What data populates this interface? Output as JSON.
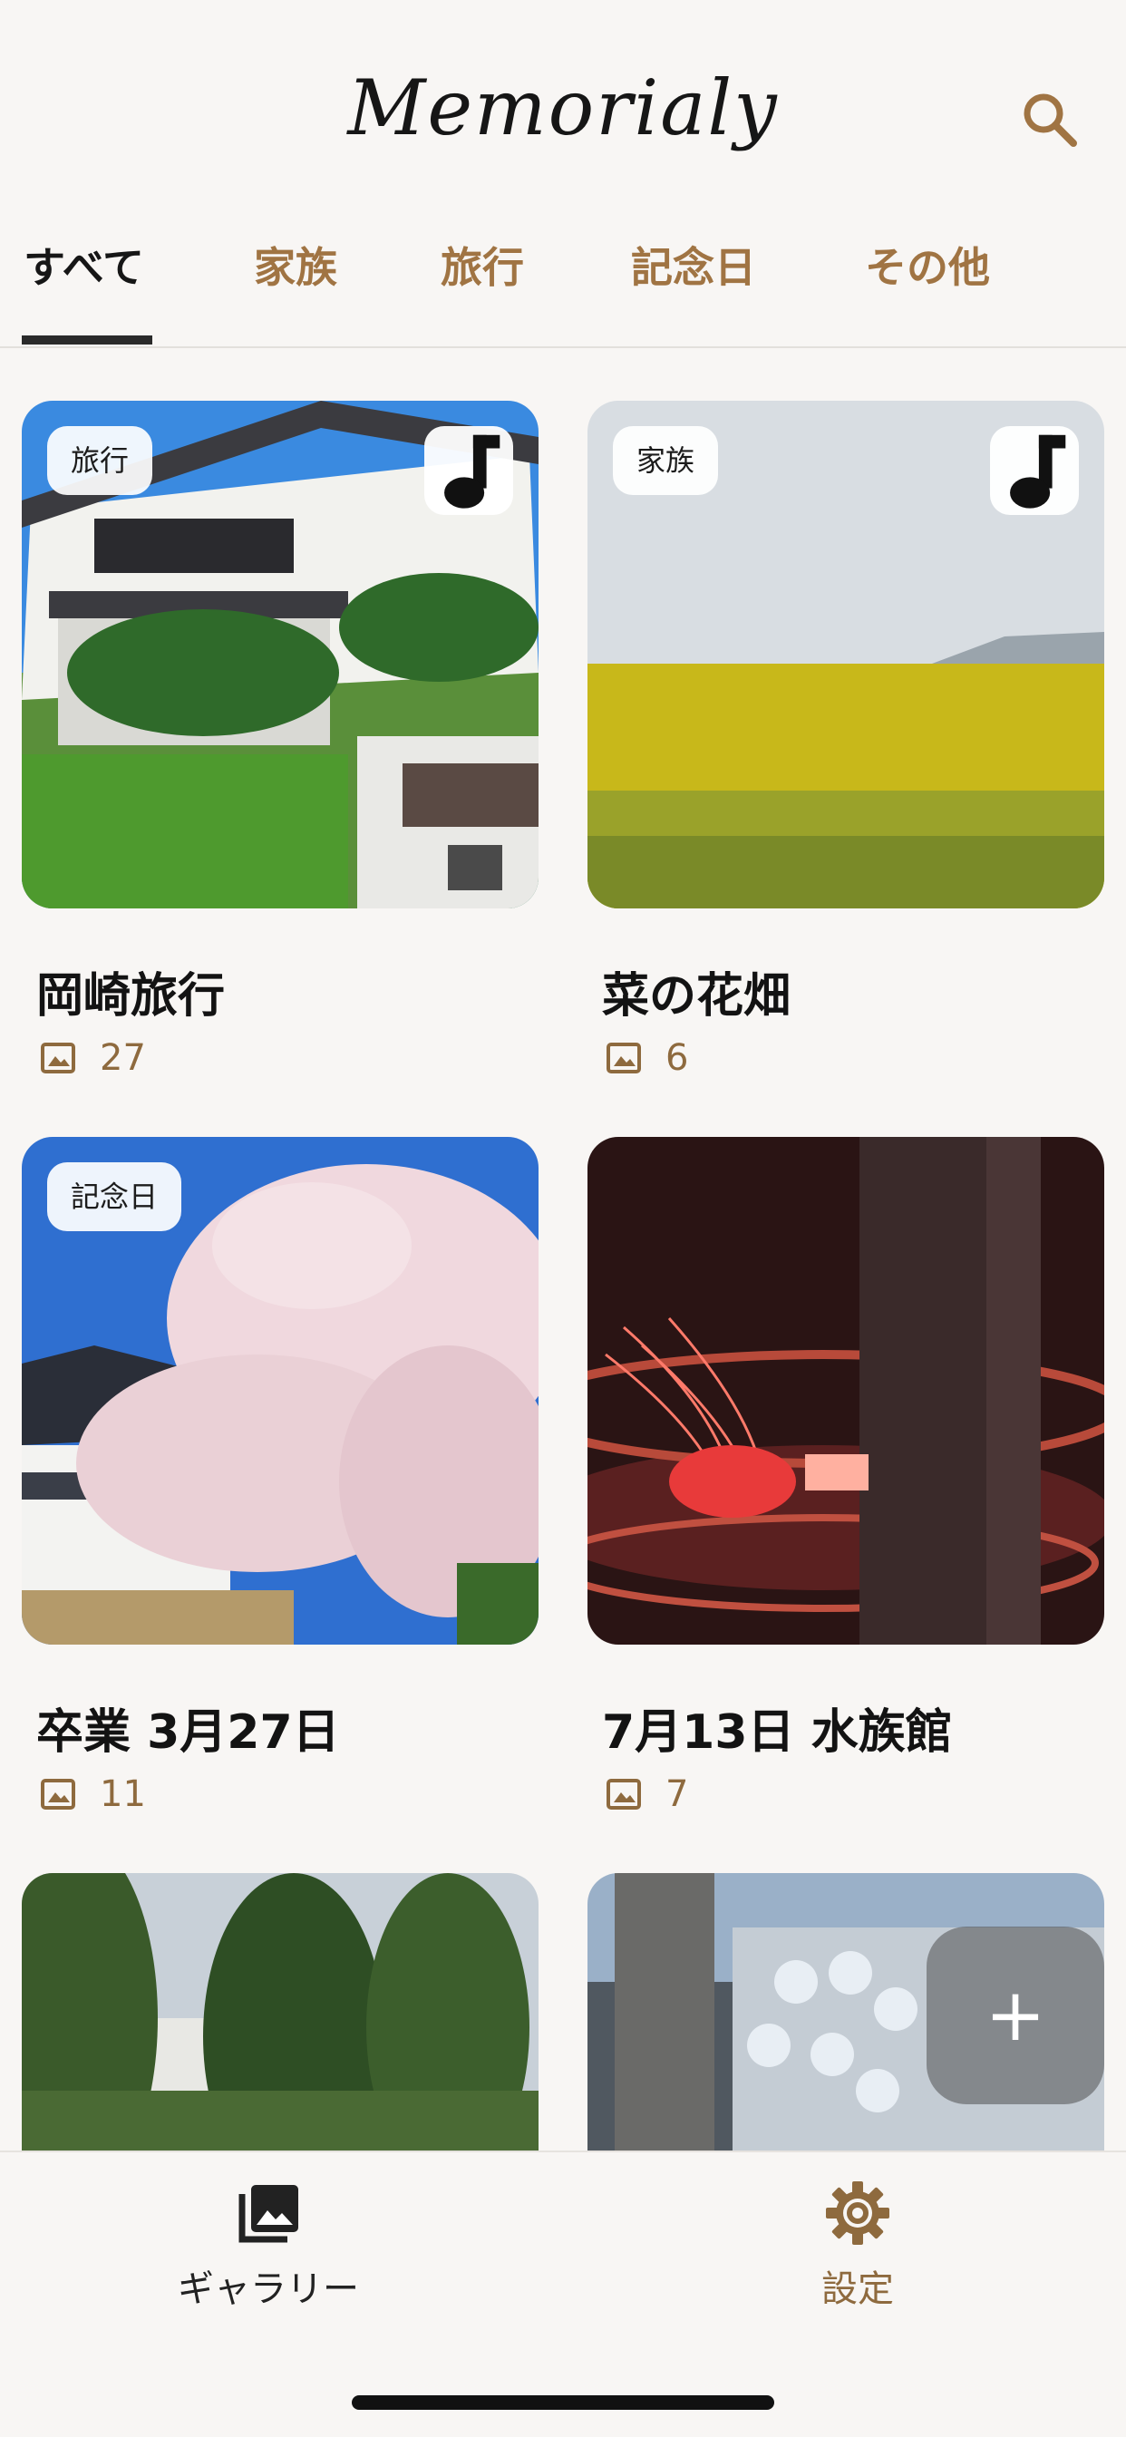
{
  "header": {
    "title": "Memorialy",
    "search_icon": "search-icon"
  },
  "tabs": [
    {
      "label": "すべて",
      "active": true
    },
    {
      "label": "家族",
      "active": false
    },
    {
      "label": "旅行",
      "active": false
    },
    {
      "label": "記念日",
      "active": false
    },
    {
      "label": "その他",
      "active": false
    }
  ],
  "albums": [
    {
      "title": "岡崎旅行",
      "count": "27",
      "badge": "旅行",
      "has_music": true,
      "photo": "castle"
    },
    {
      "title": "菜の花畑",
      "count": "6",
      "badge": "家族",
      "has_music": true,
      "photo": "field"
    },
    {
      "title": "卒業 3月27日",
      "count": "11",
      "badge": "記念日",
      "has_music": false,
      "photo": "sakura"
    },
    {
      "title": "7月13日 水族館",
      "count": "7",
      "badge": "",
      "has_music": false,
      "photo": "jellyfish"
    },
    {
      "title": "",
      "count": "",
      "badge": "",
      "has_music": false,
      "photo": "trees"
    },
    {
      "title": "",
      "count": "",
      "badge": "",
      "has_music": false,
      "photo": "sculpture"
    }
  ],
  "fab": {
    "icon": "plus-icon",
    "label": "+"
  },
  "bottom_nav": [
    {
      "label": "ギャラリー",
      "icon": "gallery-icon",
      "active": true
    },
    {
      "label": "設定",
      "icon": "gear-icon",
      "active": false
    }
  ],
  "colors": {
    "accent": "#a07443",
    "background": "#f8f6f4",
    "text": "#161616"
  }
}
